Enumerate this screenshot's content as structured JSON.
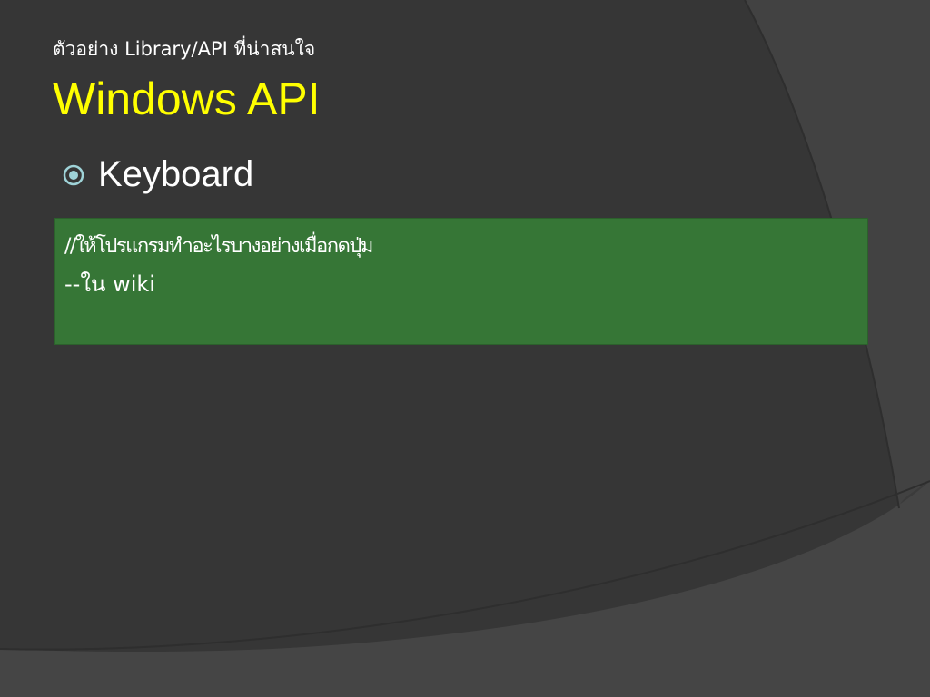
{
  "slide": {
    "subtitle": "ตัวอย่าง Library/API ที่น่าสนใจ",
    "title": "Windows API",
    "bullet": {
      "icon": "circled-dot-icon",
      "text": "Keyboard"
    },
    "code_box": {
      "line1": "//ให้โปรแกรมทำอะไรบางอย่างเมื่อกดปุ่ม",
      "line2": "--ใน wiki"
    }
  },
  "colors": {
    "background": "#3a3a3a",
    "title": "#ffff00",
    "text": "#ffffff",
    "code_box": "#367636",
    "bullet_icon": "#9fd3d8"
  }
}
